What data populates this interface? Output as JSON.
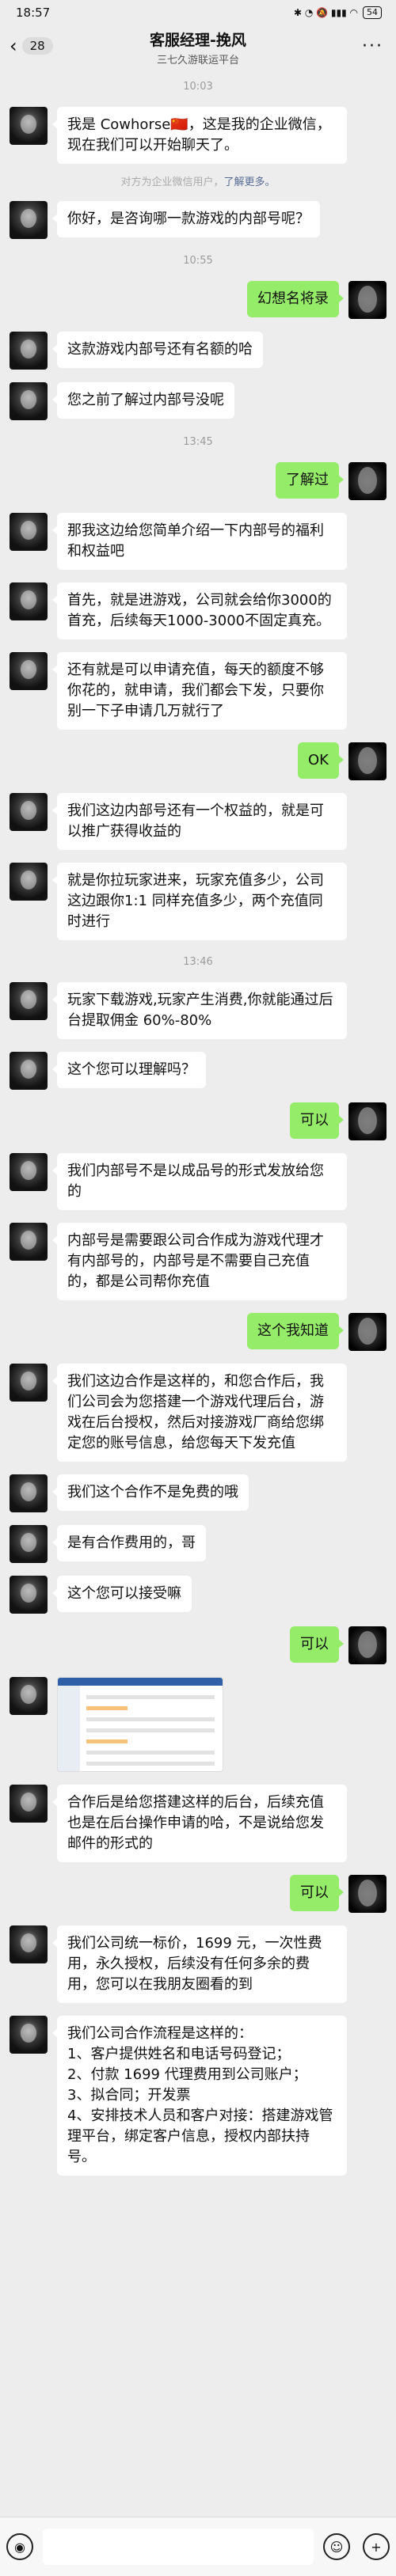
{
  "status": {
    "time": "18:57",
    "battery": "54",
    "icons": "✱ ◔ 🔕 ▮▮▮ ◠"
  },
  "header": {
    "back_count": "28",
    "title": "客服经理-挽风",
    "subtitle": "三七久游联运平台"
  },
  "notice": {
    "text": "对方为企业微信用户，",
    "link": "了解更多。"
  },
  "messages": [
    {
      "type": "time",
      "text": "10:03"
    },
    {
      "type": "left",
      "text": "我是 Cowhorse🇨🇳，这是我的企业微信，现在我们可以开始聊天了。"
    },
    {
      "type": "notice"
    },
    {
      "type": "left",
      "text": "你好，是咨询哪一款游戏的内部号呢？"
    },
    {
      "type": "time",
      "text": "10:55"
    },
    {
      "type": "right",
      "text": "幻想名将录"
    },
    {
      "type": "left",
      "text": "这款游戏内部号还有名额的哈"
    },
    {
      "type": "left",
      "text": "您之前了解过内部号没呢"
    },
    {
      "type": "time",
      "text": "13:45"
    },
    {
      "type": "right",
      "text": "了解过"
    },
    {
      "type": "left",
      "text": "那我这边给您简单介绍一下内部号的福利和权益吧"
    },
    {
      "type": "left",
      "text": "首先，就是进游戏，公司就会给你3000的首充，后续每天1000-3000不固定真充。"
    },
    {
      "type": "left",
      "text": "还有就是可以申请充值，每天的额度不够你花的，就申请，我们都会下发，只要你别一下子申请几万就行了"
    },
    {
      "type": "right",
      "text": "OK"
    },
    {
      "type": "left",
      "text": "我们这边内部号还有一个权益的，就是可以推广获得收益的"
    },
    {
      "type": "left",
      "text": "就是你拉玩家进来，玩家充值多少，公司这边跟你1:1 同样充值多少，两个充值同时进行"
    },
    {
      "type": "time",
      "text": "13:46"
    },
    {
      "type": "left",
      "text": "玩家下载游戏,玩家产生消费,你就能通过后台提取佣金 60%-80%"
    },
    {
      "type": "left",
      "text": "这个您可以理解吗？"
    },
    {
      "type": "right",
      "text": "可以"
    },
    {
      "type": "left",
      "text": "我们内部号不是以成品号的形式发放给您的"
    },
    {
      "type": "left",
      "text": "内部号是需要跟公司合作成为游戏代理才有内部号的，内部号是不需要自己充值的，都是公司帮你充值"
    },
    {
      "type": "right",
      "text": "这个我知道"
    },
    {
      "type": "left",
      "text": "我们这边合作是这样的，和您合作后，我们公司会为您搭建一个游戏代理后台，游戏在后台授权，然后对接游戏厂商给您绑定您的账号信息，给您每天下发充值"
    },
    {
      "type": "left",
      "text": "我们这个合作不是免费的哦"
    },
    {
      "type": "left",
      "text": "是有合作费用的，哥"
    },
    {
      "type": "left",
      "text": "这个您可以接受嘛"
    },
    {
      "type": "right",
      "text": "可以"
    },
    {
      "type": "image"
    },
    {
      "type": "left",
      "text": "合作后是给您搭建这样的后台，后续充值也是在后台操作申请的哈，不是说给您发邮件的形式的"
    },
    {
      "type": "right",
      "text": "可以"
    },
    {
      "type": "left",
      "text": "我们公司统一标价，1699 元，一次性费用，永久授权，后续没有任何多余的费用，您可以在我朋友圈看的到"
    },
    {
      "type": "left",
      "text": "我们公司合作流程是这样的：\n1、客户提供姓名和电话号码登记；\n2、付款 1699 代理费用到公司账户；\n3、拟合同；开发票\n4、安排技术人员和客户对接：搭建游戏管理平台，绑定客户信息，授权内部扶持号。"
    }
  ],
  "input": {
    "voice_icon": "voice-icon",
    "emoji_icon": "emoji-icon",
    "plus_icon": "plus-icon"
  }
}
